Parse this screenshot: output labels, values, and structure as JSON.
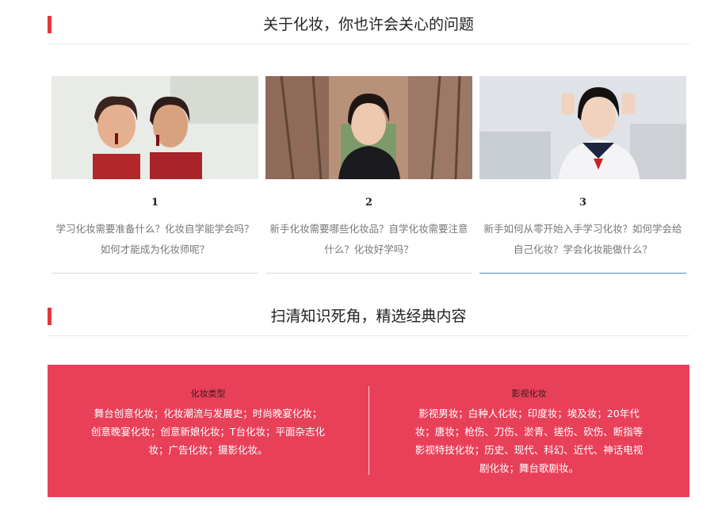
{
  "section1": {
    "title": "关于化妆，你也许会关心的问题"
  },
  "cards": [
    {
      "number": "1",
      "line1": "学习化妆需要准备什么？化妆自学能学会吗？",
      "line2": "如何才能成为化妆师呢？"
    },
    {
      "number": "2",
      "line1": "新手化妆需要哪些化妆品？自学化妆需要注意",
      "line2": "什么？化妆好学吗？"
    },
    {
      "number": "3",
      "line1": "新手如何从零开始入手学习化妆？如何学会给",
      "line2": "自己化妆？学会化妆能做什么？"
    }
  ],
  "section2": {
    "title": "扫清知识死角，精选经典内容"
  },
  "panel": {
    "left": {
      "heading": "化妆类型",
      "text": "舞台创意化妆；化妆潮流与发展史；时尚晚宴化妆；创意晚宴化妆；创意新娘化妆；T台化妆；平面杂志化妆；广告化妆；摄影化妆。"
    },
    "right": {
      "heading": "影视化妆",
      "text": "影视男妆；白种人化妆；印度妆；埃及妆；20年代妆；唐妆；枪伤、刀伤、淤青、搓伤、砍伤、断指等影视特技化妆；历史、现代、科幻、近代、神话电视剧化妆；舞台歌剧妆。"
    }
  },
  "colors": {
    "accent": "#e03a3e",
    "panel": "#e9405a",
    "active_underline": "#4a90c8"
  }
}
